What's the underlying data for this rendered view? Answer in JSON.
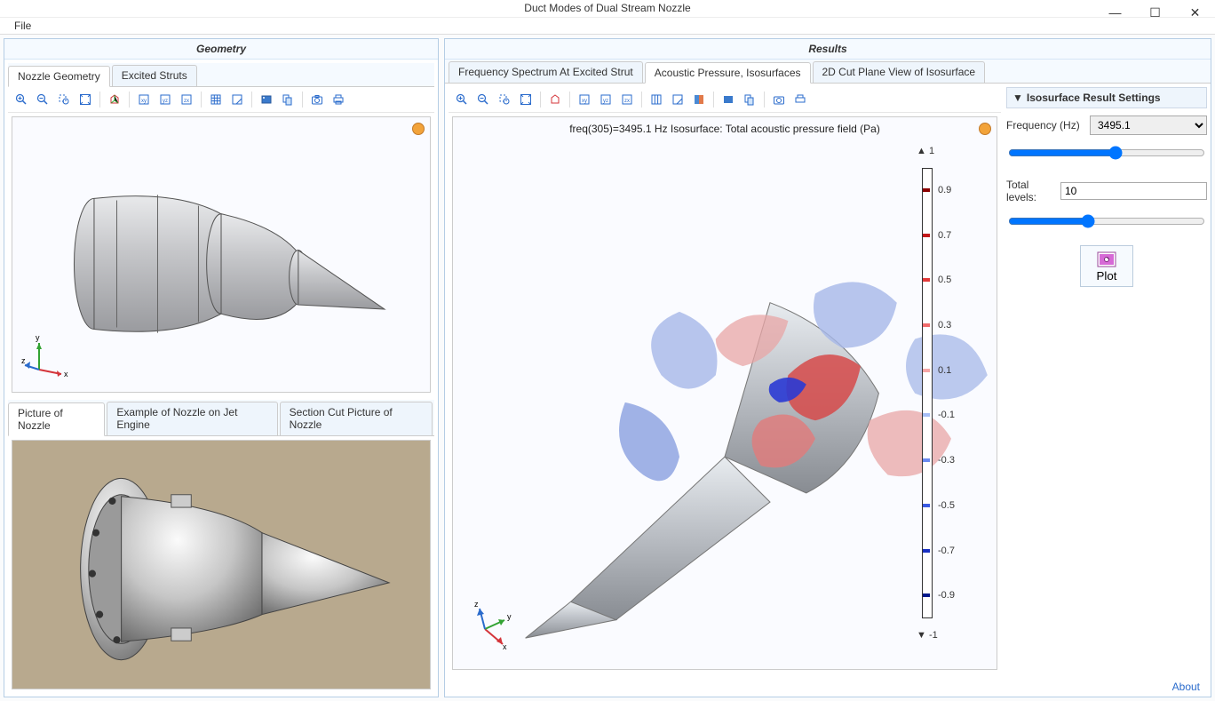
{
  "window": {
    "title": "Duct Modes of Dual Stream Nozzle",
    "min": "—",
    "max": "☐",
    "close": "✕"
  },
  "menu": {
    "file": "File"
  },
  "left": {
    "header": "Geometry",
    "tabs_top": [
      "Nozzle Geometry",
      "Excited Struts"
    ],
    "active_top": 0,
    "tabs_bottom": [
      "Picture of Nozzle",
      "Example of Nozzle on Jet Engine",
      "Section Cut Picture of Nozzle"
    ],
    "active_bottom": 0
  },
  "right": {
    "header": "Results",
    "tabs": [
      "Frequency Spectrum At Excited Strut",
      "Acoustic Pressure, Isosurfaces",
      "2D Cut Plane View of Isosurface"
    ],
    "active": 1,
    "plot_title": "freq(305)=3495.1 Hz   Isosurface: Total acoustic pressure field (Pa)"
  },
  "settings": {
    "header": "Isosurface Result Settings",
    "freq_label": "Frequency (Hz)",
    "freq_value": "3495.1",
    "levels_label": "Total levels:",
    "levels_value": "10",
    "plot_btn": "Plot"
  },
  "colorbar": {
    "top": "▲ 1",
    "bottom": "▼ -1",
    "ticks": [
      {
        "v": 0.9,
        "c": "#8b0000"
      },
      {
        "v": 0.7,
        "c": "#c21818"
      },
      {
        "v": 0.5,
        "c": "#e23a3a"
      },
      {
        "v": 0.3,
        "c": "#f06a6a"
      },
      {
        "v": 0.1,
        "c": "#f6a6a6"
      },
      {
        "v": -0.1,
        "c": "#a6bdf6"
      },
      {
        "v": -0.3,
        "c": "#6a8af0"
      },
      {
        "v": -0.5,
        "c": "#3a5ae2"
      },
      {
        "v": -0.7,
        "c": "#1830c2"
      },
      {
        "v": -0.9,
        "c": "#00188b"
      }
    ]
  },
  "footer": {
    "about": "About"
  },
  "axes": {
    "x": "x",
    "y": "y",
    "z": "z"
  }
}
